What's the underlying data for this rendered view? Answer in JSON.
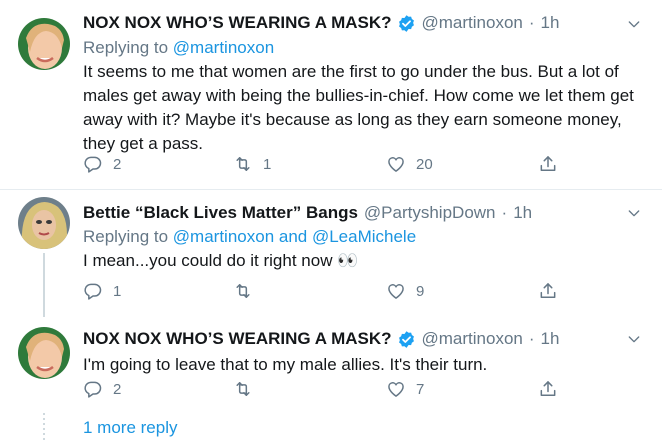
{
  "tweets": [
    {
      "name": "NOX NOX WHO’S WEARING A MASK?",
      "verified": true,
      "handle": "@martinoxon",
      "separator": "·",
      "time": "1h",
      "replying_prefix": "Replying to",
      "replying_to": "@martinoxon",
      "text": "It seems to me that women are the first to go under the bus. But a lot of males get away with being the bullies-in-chief. How come we let them get away with it? Maybe it's because as long as they earn someone money, they get a pass.",
      "replies": "2",
      "retweets": "1",
      "likes": "20"
    },
    {
      "name": "Bettie “Black Lives Matter” Bangs",
      "verified": false,
      "handle": "@PartyshipDown",
      "separator": "·",
      "time": "1h",
      "replying_prefix": "Replying to",
      "replying_to": "@martinoxon and @LeaMichele",
      "text": "I mean...you could do it right now 👀",
      "replies": "1",
      "retweets": "",
      "likes": "9"
    },
    {
      "name": "NOX NOX WHO’S WEARING A MASK?",
      "verified": true,
      "handle": "@martinoxon",
      "separator": "·",
      "time": "1h",
      "text": "I'm going to leave that to my male allies. It's their turn.",
      "replies": "2",
      "retweets": "",
      "likes": "7"
    }
  ],
  "more_replies": "1 more reply",
  "colors": {
    "link": "#1b95e0",
    "muted": "#657786",
    "text": "#14171a",
    "verified": "#1da1f2"
  },
  "icons": [
    "reply-icon",
    "retweet-icon",
    "like-icon",
    "share-icon",
    "verified-icon",
    "chevron-down-icon"
  ]
}
